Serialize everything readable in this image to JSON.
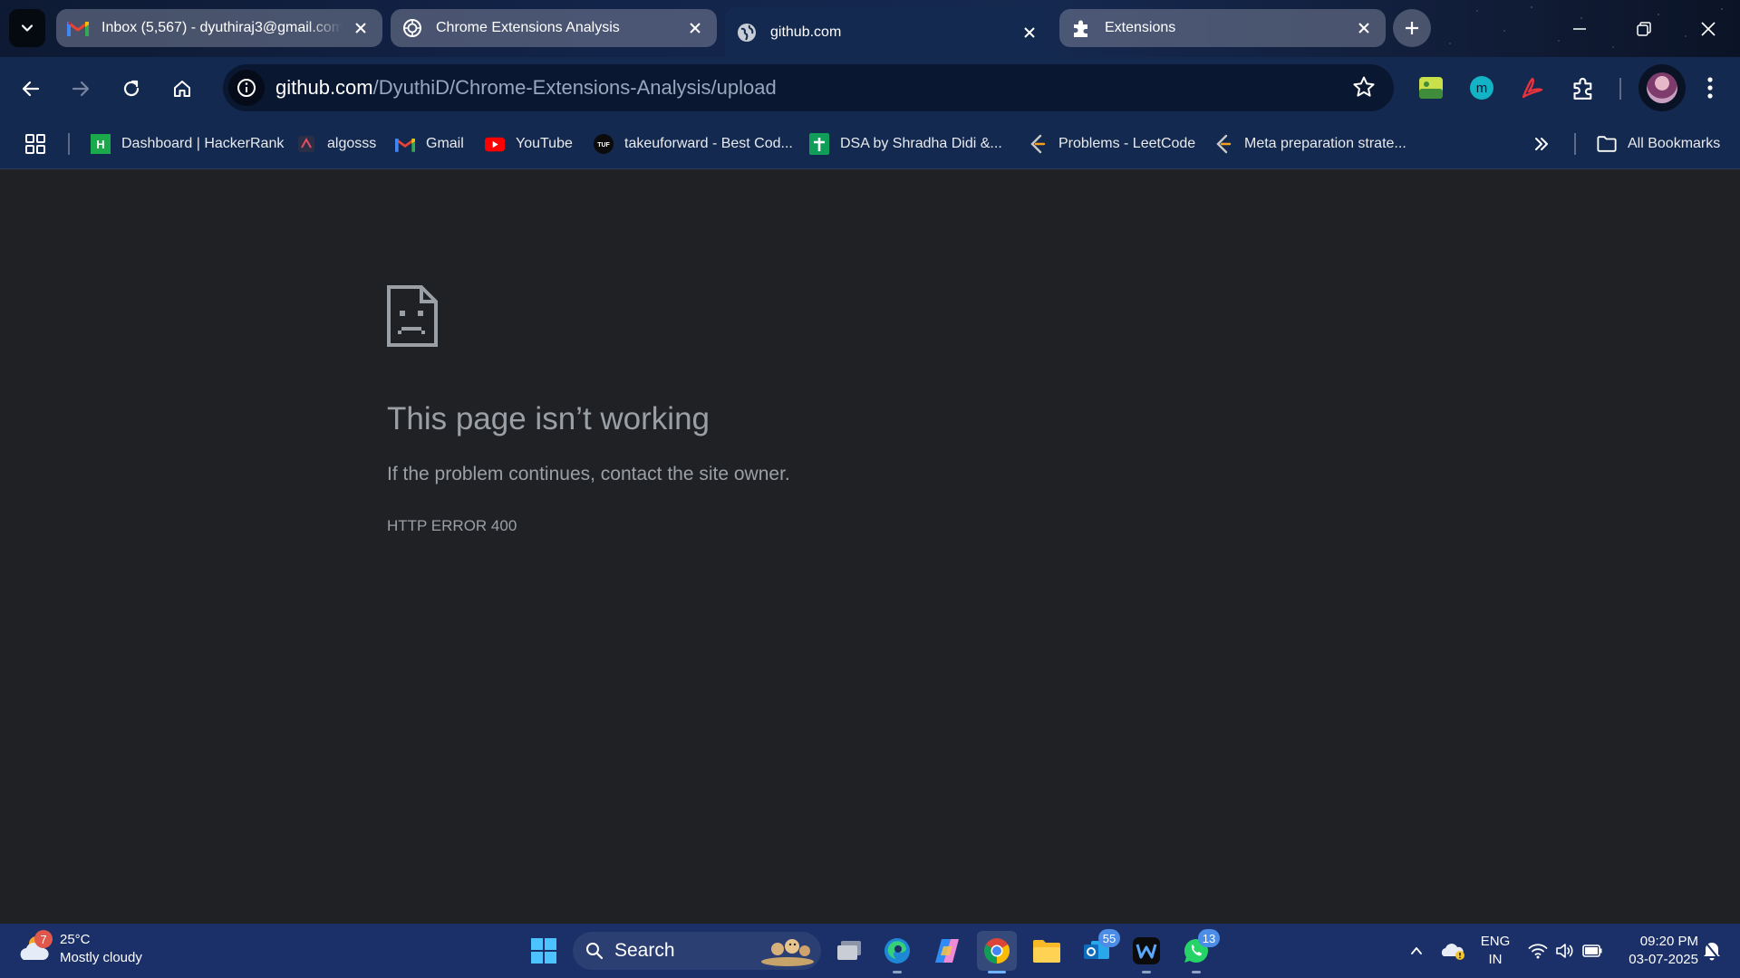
{
  "tabs": [
    {
      "title": "Inbox (5,567) - dyuthiraj3@gmail.com",
      "favicon": "gmail-icon",
      "active": false
    },
    {
      "title": "Chrome Extensions Analysis",
      "favicon": "chatgpt-icon",
      "active": false
    },
    {
      "title": "github.com",
      "favicon": "globe-icon",
      "active": true
    },
    {
      "title": "Extensions",
      "favicon": "puzzle-icon",
      "active": false
    }
  ],
  "address_bar": {
    "host": "github.com",
    "path": "/DyuthiD/Chrome-Extensions-Analysis/upload"
  },
  "bookmarks": [
    {
      "label": "Dashboard | HackerRank",
      "icon": "hackerrank-icon"
    },
    {
      "label": "algosss",
      "icon": "algo-icon"
    },
    {
      "label": "Gmail",
      "icon": "gmail-icon"
    },
    {
      "label": "YouTube",
      "icon": "youtube-icon"
    },
    {
      "label": "takeuforward - Best Cod...",
      "icon": "tuf-icon"
    },
    {
      "label": "DSA by Shradha Didi &...",
      "icon": "sheets-icon"
    },
    {
      "label": "Problems - LeetCode",
      "icon": "leetcode-icon"
    },
    {
      "label": "Meta preparation strate...",
      "icon": "leetcode-icon"
    }
  ],
  "all_bookmarks_label": "All Bookmarks",
  "error": {
    "title": "This page isn’t working",
    "message": "If the problem continues, contact the site owner.",
    "code": "HTTP ERROR 400"
  },
  "taskbar": {
    "weather": {
      "temp": "25°C",
      "condition": "Mostly cloudy",
      "badge": "7"
    },
    "search_label": "Search",
    "outlook_badge": "55",
    "whatsapp_badge": "13",
    "language": "ENG",
    "region": "IN",
    "time": "09:20 PM",
    "date": "03-07-2025"
  },
  "colors": {
    "frame": "#13294f",
    "page_bg": "#202124",
    "error_text": "#9aa0a6",
    "taskbar": "#1b3069"
  }
}
